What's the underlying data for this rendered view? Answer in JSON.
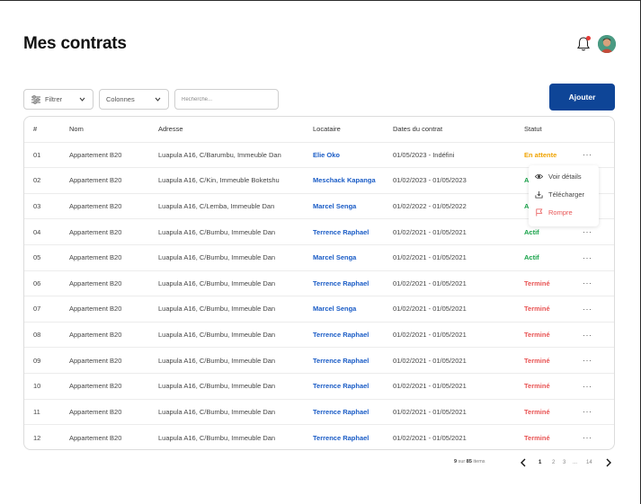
{
  "header": {
    "title": "Mes contrats"
  },
  "toolbar": {
    "filter_label": "Filtrer",
    "columns_label": "Colonnes",
    "search_placeholder": "Recherche...",
    "add_label": "Ajouter"
  },
  "table": {
    "columns": [
      "#",
      "Nom",
      "Adresse",
      "Locataire",
      "Dates du contrat",
      "Statut"
    ],
    "rows": [
      {
        "num": "01",
        "nom": "Appartement B20",
        "adresse": "Luapula A16, C/Barumbu, Immeuble Dan",
        "locataire": "Elie Oko",
        "dates": "01/05/2023 - Indéfini",
        "statut": "En attente",
        "status_kind": "attente"
      },
      {
        "num": "02",
        "nom": "Appartement B20",
        "adresse": "Luapula A16, C/Kin, Immeuble Boketshu",
        "locataire": "Meschack Kapanga",
        "dates": "01/02/2023 - 01/05/2023",
        "statut": "A",
        "status_kind": "actif"
      },
      {
        "num": "03",
        "nom": "Appartement B20",
        "adresse": "Luapula A16, C/Lemba, Immeuble Dan",
        "locataire": "Marcel Senga",
        "dates": "01/02/2022 - 01/05/2022",
        "statut": "A",
        "status_kind": "actif"
      },
      {
        "num": "04",
        "nom": "Appartement B20",
        "adresse": "Luapula A16, C/Bumbu, Immeuble Dan",
        "locataire": "Terrence Raphael",
        "dates": "01/02/2021 - 01/05/2021",
        "statut": "Actif",
        "status_kind": "actif"
      },
      {
        "num": "05",
        "nom": "Appartement B20",
        "adresse": "Luapula A16, C/Bumbu, Immeuble Dan",
        "locataire": "Marcel Senga",
        "dates": "01/02/2021 - 01/05/2021",
        "statut": "Actif",
        "status_kind": "actif"
      },
      {
        "num": "06",
        "nom": "Appartement B20",
        "adresse": "Luapula A16, C/Bumbu, Immeuble Dan",
        "locataire": "Terrence Raphael",
        "dates": "01/02/2021 - 01/05/2021",
        "statut": "Terminé",
        "status_kind": "termine"
      },
      {
        "num": "07",
        "nom": "Appartement B20",
        "adresse": "Luapula A16, C/Bumbu, Immeuble Dan",
        "locataire": "Marcel Senga",
        "dates": "01/02/2021 - 01/05/2021",
        "statut": "Terminé",
        "status_kind": "termine"
      },
      {
        "num": "08",
        "nom": "Appartement B20",
        "adresse": "Luapula A16, C/Bumbu, Immeuble Dan",
        "locataire": "Terrence Raphael",
        "dates": "01/02/2021 - 01/05/2021",
        "statut": "Terminé",
        "status_kind": "termine"
      },
      {
        "num": "09",
        "nom": "Appartement B20",
        "adresse": "Luapula A16, C/Bumbu, Immeuble Dan",
        "locataire": "Terrence Raphael",
        "dates": "01/02/2021 - 01/05/2021",
        "statut": "Terminé",
        "status_kind": "termine"
      },
      {
        "num": "10",
        "nom": "Appartement B20",
        "adresse": "Luapula A16, C/Bumbu, Immeuble Dan",
        "locataire": "Terrence Raphael",
        "dates": "01/02/2021 - 01/05/2021",
        "statut": "Terminé",
        "status_kind": "termine"
      },
      {
        "num": "11",
        "nom": "Appartement B20",
        "adresse": "Luapula A16, C/Bumbu, Immeuble Dan",
        "locataire": "Terrence Raphael",
        "dates": "01/02/2021 - 01/05/2021",
        "statut": "Terminé",
        "status_kind": "termine"
      },
      {
        "num": "12",
        "nom": "Appartement B20",
        "adresse": "Luapula A16, C/Bumbu, Immeuble Dan",
        "locataire": "Terrence Raphael",
        "dates": "01/02/2021 - 01/05/2021",
        "statut": "Terminé",
        "status_kind": "termine"
      }
    ],
    "more_label": "···"
  },
  "context_menu": {
    "items": [
      {
        "label": "Voir détails",
        "icon": "eye-icon"
      },
      {
        "label": "Télécharger",
        "icon": "download-icon"
      },
      {
        "label": "Rompre",
        "icon": "flag-icon"
      }
    ]
  },
  "pagination": {
    "current": "9",
    "middle": "sur",
    "total": "85",
    "suffix": "items",
    "pages": [
      "1",
      "2",
      "3",
      "...",
      "14"
    ]
  },
  "colors": {
    "primary": "#0e4597",
    "link": "#1a5cc6",
    "pending": "#f0a300",
    "active": "#19a34a",
    "ended": "#e85454"
  }
}
